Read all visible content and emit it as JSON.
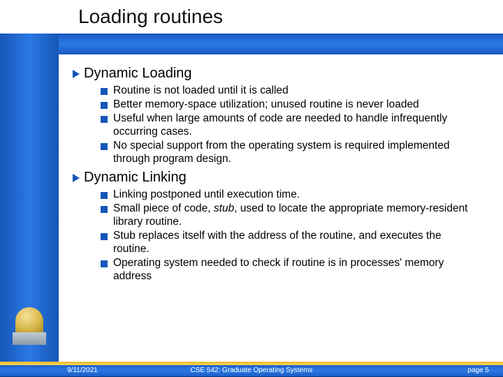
{
  "title": "Loading routines",
  "sections": [
    {
      "heading": "Dynamic Loading",
      "items": [
        "Routine is not loaded until it is called",
        "Better memory-space utilization; unused routine is never loaded",
        "Useful when large amounts of code are needed to handle infrequently occurring cases.",
        "No special support from the operating system is required implemented through program design."
      ]
    },
    {
      "heading": "Dynamic Linking",
      "items": [
        "Linking postponed until execution time.",
        "Small piece of code, stub, used to locate the appropriate memory-resident library routine.",
        "Stub replaces itself with the address of the routine, and executes the routine.",
        "Operating system needed to check if routine is in processes' memory address"
      ]
    }
  ],
  "footer": {
    "date": "9/11/2021",
    "course": "CSE 542: Graduate Operating Systems",
    "page": "page 5"
  }
}
